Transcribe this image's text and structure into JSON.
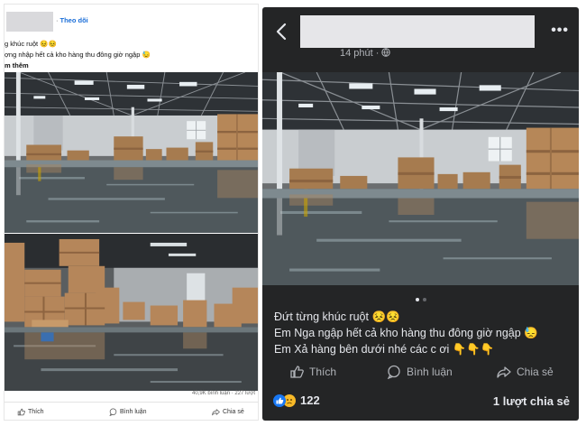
{
  "left_post": {
    "follow_label": "Theo dõi",
    "caption_line1": "g khúc ruột 😣😣",
    "caption_line2": "ợng  nhập hết cả kho hàng thu đông giờ ngập 😓",
    "caption_line3": "m thêm",
    "stats": "40,9K bình luận · 227 lượt",
    "actions": {
      "like": "Thích",
      "comment": "Bình luận",
      "share": "Chia sẻ"
    }
  },
  "right_post": {
    "time": "14 phút ·",
    "caption_line1": "Đứt từng khúc ruột 😣😣",
    "caption_line2": "Em Nga ngập hết cả kho hàng thu đông giờ ngập 😓",
    "caption_line3": "Em Xả hàng bên dưới nhé các c ơi 👇👇👇",
    "actions": {
      "like": "Thích",
      "comment": "Bình luận",
      "share": "Chia sẻ"
    },
    "reaction_count": "122",
    "share_count": "1 lượt chia sẻ",
    "carousel": {
      "total": 2,
      "active": 1
    }
  },
  "colors": {
    "dark_bg": "#242526",
    "dark_text": "#e4e6eb",
    "dark_muted": "#b0b3b8",
    "link_blue": "#1a6ed8",
    "like_blue": "#1877f2",
    "sad_yellow": "#f7b928"
  },
  "icons": [
    "back-chevron-icon",
    "more-dots-icon",
    "globe-icon",
    "like-thumb-icon",
    "comment-bubble-icon",
    "share-arrow-icon",
    "like-reaction-icon",
    "sad-reaction-icon"
  ]
}
